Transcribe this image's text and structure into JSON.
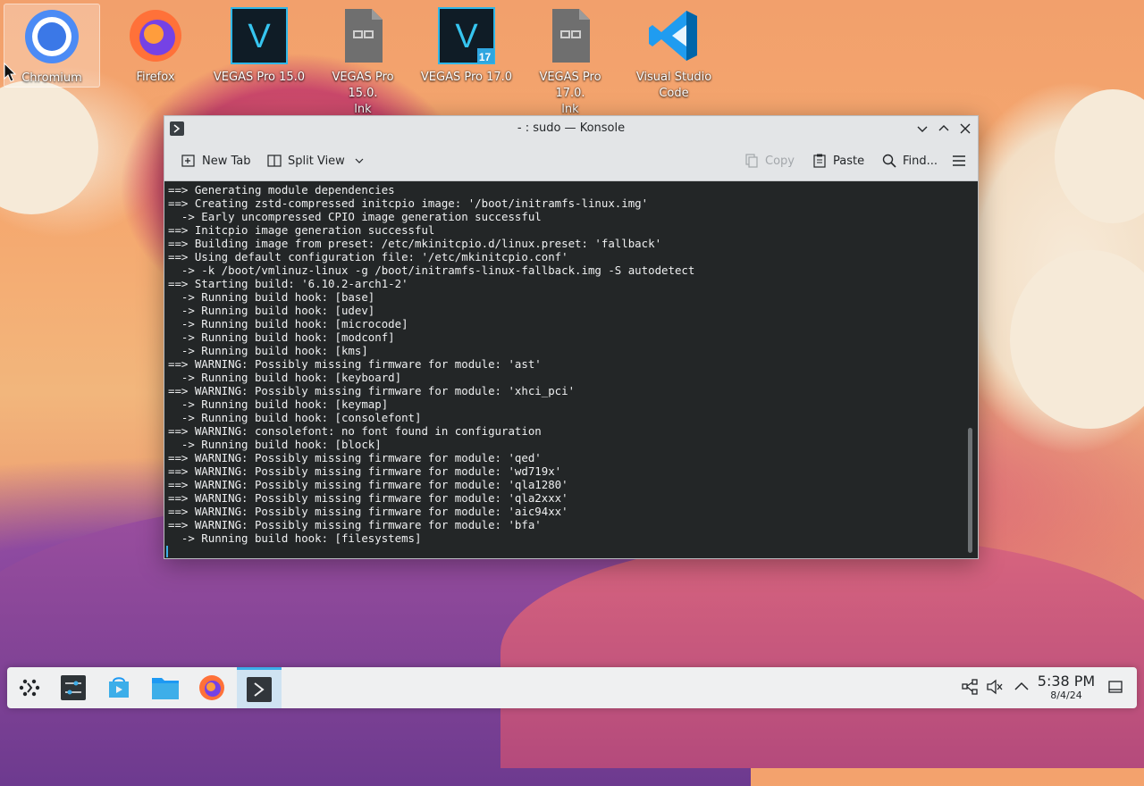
{
  "desktop": {
    "icons": [
      {
        "label": "Chromium",
        "icon": "chromium-icon"
      },
      {
        "label": "Firefox",
        "icon": "firefox-icon"
      },
      {
        "label": "VEGAS Pro 15.0",
        "icon": "vegas-icon"
      },
      {
        "label": "VEGAS Pro 15.0.\nlnk",
        "icon": "link-file-icon"
      },
      {
        "label": "VEGAS Pro 17.0",
        "icon": "vegas-17-icon",
        "badge": "17"
      },
      {
        "label": "VEGAS Pro 17.0.\nlnk",
        "icon": "link-file-icon"
      },
      {
        "label": "Visual Studio\nCode",
        "icon": "vscode-icon"
      }
    ]
  },
  "window": {
    "title": "- : sudo — Konsole",
    "toolbar": {
      "new_tab": "New Tab",
      "split_view": "Split View",
      "copy": "Copy",
      "paste": "Paste",
      "find": "Find..."
    },
    "terminal_lines": [
      "==> Generating module dependencies",
      "==> Creating zstd-compressed initcpio image: '/boot/initramfs-linux.img'",
      "  -> Early uncompressed CPIO image generation successful",
      "==> Initcpio image generation successful",
      "==> Building image from preset: /etc/mkinitcpio.d/linux.preset: 'fallback'",
      "==> Using default configuration file: '/etc/mkinitcpio.conf'",
      "  -> -k /boot/vmlinuz-linux -g /boot/initramfs-linux-fallback.img -S autodetect",
      "==> Starting build: '6.10.2-arch1-2'",
      "  -> Running build hook: [base]",
      "  -> Running build hook: [udev]",
      "  -> Running build hook: [microcode]",
      "  -> Running build hook: [modconf]",
      "  -> Running build hook: [kms]",
      "==> WARNING: Possibly missing firmware for module: 'ast'",
      "  -> Running build hook: [keyboard]",
      "==> WARNING: Possibly missing firmware for module: 'xhci_pci'",
      "  -> Running build hook: [keymap]",
      "  -> Running build hook: [consolefont]",
      "==> WARNING: consolefont: no font found in configuration",
      "  -> Running build hook: [block]",
      "==> WARNING: Possibly missing firmware for module: 'qed'",
      "==> WARNING: Possibly missing firmware for module: 'wd719x'",
      "==> WARNING: Possibly missing firmware for module: 'qla1280'",
      "==> WARNING: Possibly missing firmware for module: 'qla2xxx'",
      "==> WARNING: Possibly missing firmware for module: 'aic94xx'",
      "==> WARNING: Possibly missing firmware for module: 'bfa'",
      "  -> Running build hook: [filesystems]"
    ]
  },
  "taskbar": {
    "apps": [
      "application-launcher-icon",
      "system-settings-icon",
      "discover-icon",
      "file-manager-icon",
      "firefox-icon",
      "konsole-icon"
    ],
    "clock_time": "5:38 PM",
    "clock_date": "8/4/24"
  }
}
